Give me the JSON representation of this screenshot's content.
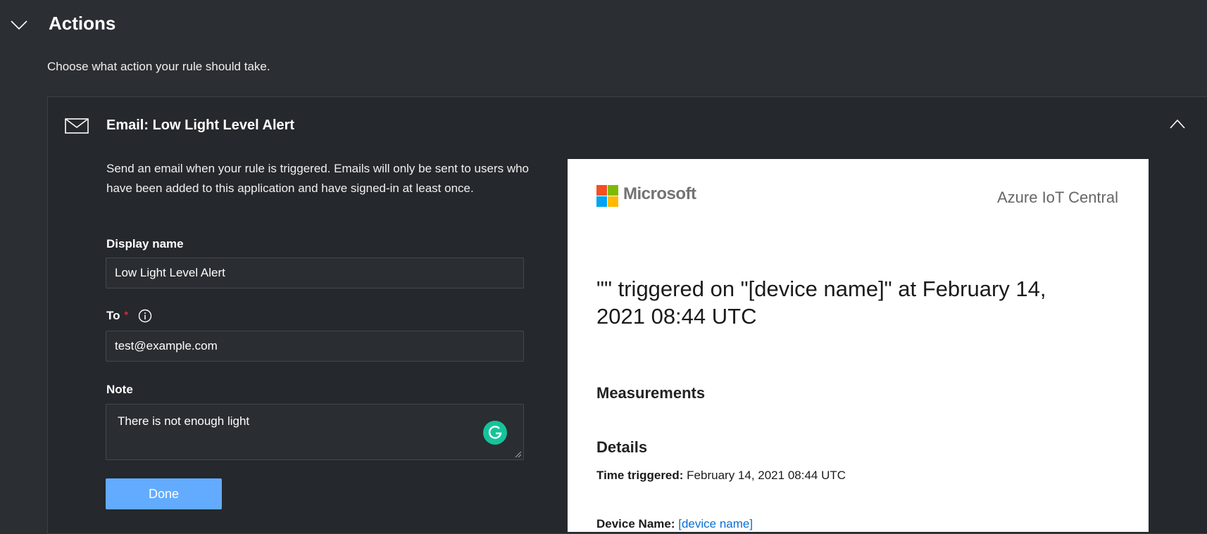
{
  "section": {
    "title": "Actions",
    "subtitle": "Choose what action your rule should take."
  },
  "action_card": {
    "title": "Email: Low Light Level Alert",
    "description": "Send an email when your rule is triggered. Emails will only be sent to users who have been added to this application and have signed-in at least once.",
    "display_name_label": "Display name",
    "display_name_value": "Low Light Level Alert",
    "to_label": "To",
    "to_required": "*",
    "to_value": "test@example.com",
    "note_label": "Note",
    "note_value": "There is not enough light",
    "done_label": "Done",
    "accent_color": "#62abff"
  },
  "preview": {
    "brand": "Microsoft",
    "product": "Azure IoT Central",
    "heading": "\"\" triggered on \"[device name]\" at February 14, 2021 08:44 UTC",
    "measurements_label": "Measurements",
    "details_label": "Details",
    "time_triggered_label": "Time triggered:",
    "time_triggered_value": "February 14, 2021 08:44 UTC",
    "device_name_label": "Device Name:",
    "device_name_value": "[device name]"
  }
}
